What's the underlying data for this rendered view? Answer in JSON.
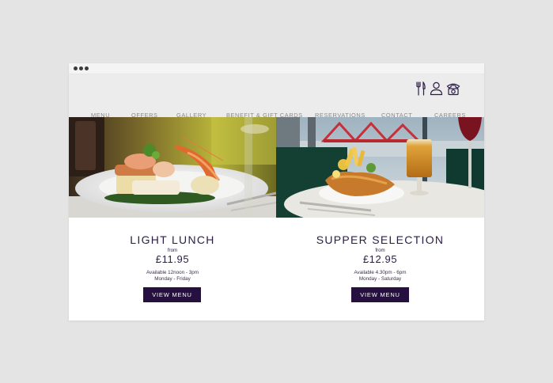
{
  "header": {
    "icons": [
      "cutlery-icon",
      "account-icon",
      "phone-icon"
    ]
  },
  "nav": {
    "items": [
      "MENU",
      "OFFERS",
      "GALLERY",
      "BENEFIT & GIFT CARDS",
      "RESERVATIONS",
      "CONTACT",
      "CAREERS"
    ]
  },
  "cards": [
    {
      "title": "LIGHT LUNCH",
      "from": "from",
      "price": "£11.95",
      "availability": "Available 12noon - 3pm",
      "days": "Monday - Friday",
      "button": "VIEW MENU"
    },
    {
      "title": "SUPPER SELECTION",
      "from": "from",
      "price": "£12.95",
      "availability": "Available 4.30pm - 6pm",
      "days": "Monday - Saturday",
      "button": "VIEW MENU"
    }
  ],
  "colors": {
    "brand": "#25103f",
    "nav_text": "#8a8a8a",
    "header_bg": "#ececec",
    "page_bg": "#e4e4e4"
  }
}
